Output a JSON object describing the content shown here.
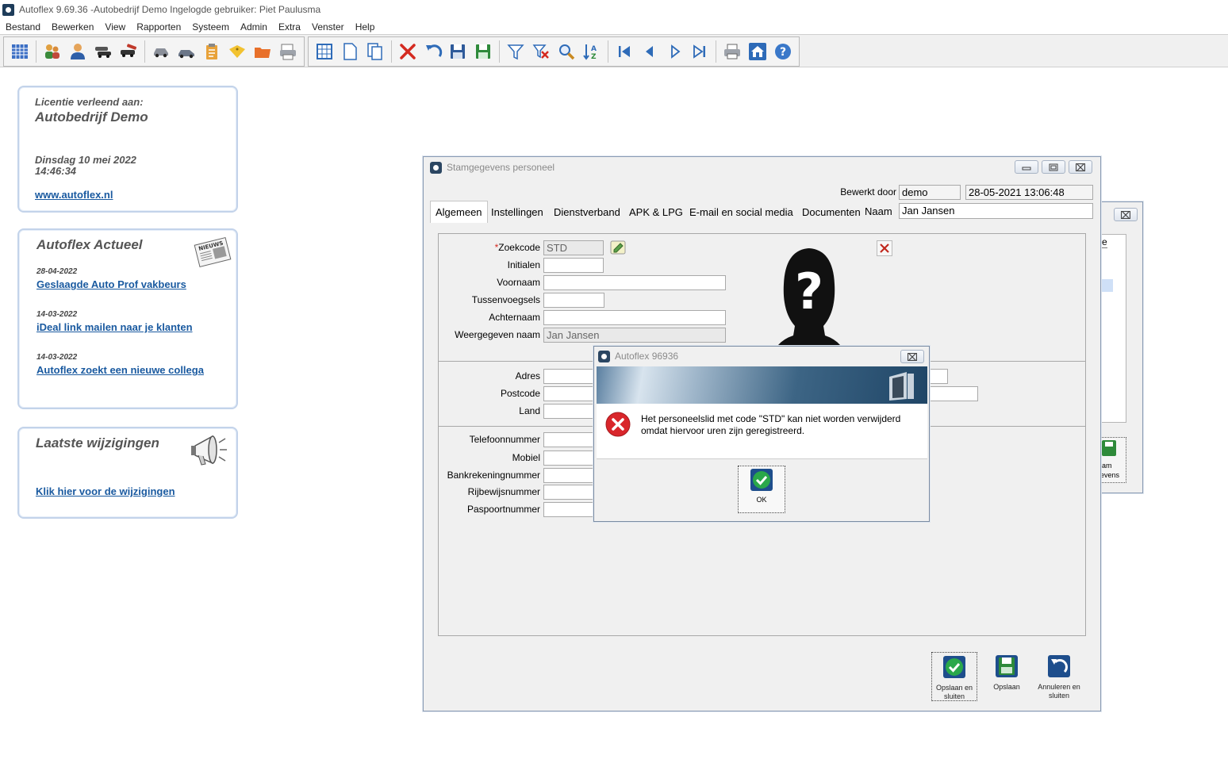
{
  "app": {
    "title": "Autoflex 9.69.36 -Autobedrijf Demo  Ingelogde gebruiker: Piet Paulusma"
  },
  "menu": [
    "Bestand",
    "Bewerken",
    "View",
    "Rapporten",
    "Systeem",
    "Admin",
    "Extra",
    "Venster",
    "Help"
  ],
  "toolbar": {
    "icons": [
      "grid-icon",
      "people-icon",
      "user-icon",
      "cars-icon",
      "car-tools-icon",
      "car-gray-icon",
      "car-side-icon",
      "clipboard-icon",
      "tag-icon",
      "folder-icon",
      "printer-stack-icon",
      "table-icon",
      "new-doc-icon",
      "copy-doc-icon",
      "delete-icon",
      "undo-icon",
      "save-icon",
      "save-green-icon",
      "filter-icon",
      "clear-filter-icon",
      "search-icon",
      "sort-az-icon",
      "first-record-icon",
      "prev-record-icon",
      "next-record-icon",
      "last-record-icon",
      "print-icon",
      "home-icon",
      "help-icon"
    ]
  },
  "license_panel": {
    "heading": "Licentie verleend aan:",
    "company": "Autobedrijf Demo",
    "date": "Dinsdag 10 mei 2022",
    "time": "14:46:34",
    "link": "www.autoflex.nl"
  },
  "news_panel": {
    "title": "Autoflex Actueel",
    "items": [
      {
        "date": "28-04-2022",
        "title": "Geslaagde Auto Prof vakbeurs"
      },
      {
        "date": "14-03-2022",
        "title": "iDeal link mailen naar je klanten"
      },
      {
        "date": "14-03-2022",
        "title": "Autoflex zoekt een nieuwe collega"
      }
    ]
  },
  "changes_panel": {
    "title": "Laatste wijzigingen",
    "link": "Klik hier voor de wijzigingen"
  },
  "back_window": {
    "partial_text_1": "e",
    "partial_text_2": "am",
    "partial_text_3": "evens"
  },
  "staff_window": {
    "title": "Stamgegevens personeel",
    "edited_by_label": "Bewerkt door",
    "edited_by_value": "demo",
    "edited_at": "28-05-2021 13:06:48",
    "name_label": "Naam",
    "name_value": "Jan Jansen",
    "tabs": [
      "Algemeen",
      "Instellingen",
      "Dienstverband",
      "APK & LPG",
      "E-mail en social media",
      "Documenten"
    ],
    "fields": {
      "zoekcode_label": "Zoekcode",
      "zoekcode_required": "*",
      "zoekcode_value": "STD",
      "initialen_label": "Initialen",
      "voornaam_label": "Voornaam",
      "tussenvoegsels_label": "Tussenvoegsels",
      "achternaam_label": "Achternaam",
      "weergegeven_label": "Weergegeven naam",
      "weergegeven_value": "Jan Jansen",
      "adres_label": "Adres",
      "postcode_label": "Postcode",
      "land_label": "Land",
      "telefoon_label": "Telefoonnummer",
      "mobiel_label": "Mobiel",
      "bank_label": "Bankrekeningnummer",
      "rijbewijs_label": "Rijbewijsnummer",
      "paspoort_label": "Paspoortnummer"
    },
    "buttons": {
      "save_close": "Opslaan en sluiten",
      "save": "Opslaan",
      "cancel_close": "Annuleren en sluiten"
    }
  },
  "dialog": {
    "title": "Autoflex 96936",
    "message_line1": "Het personeelslid met code \"STD\" kan niet worden verwijderd",
    "message_line2": "omdat hiervoor uren zijn geregistreerd.",
    "ok_label": "OK"
  },
  "colors": {
    "link": "#1a5aa0",
    "panel_border": "#c3d3ea",
    "error_red": "#d9262b",
    "ok_green": "#2aa84a"
  }
}
